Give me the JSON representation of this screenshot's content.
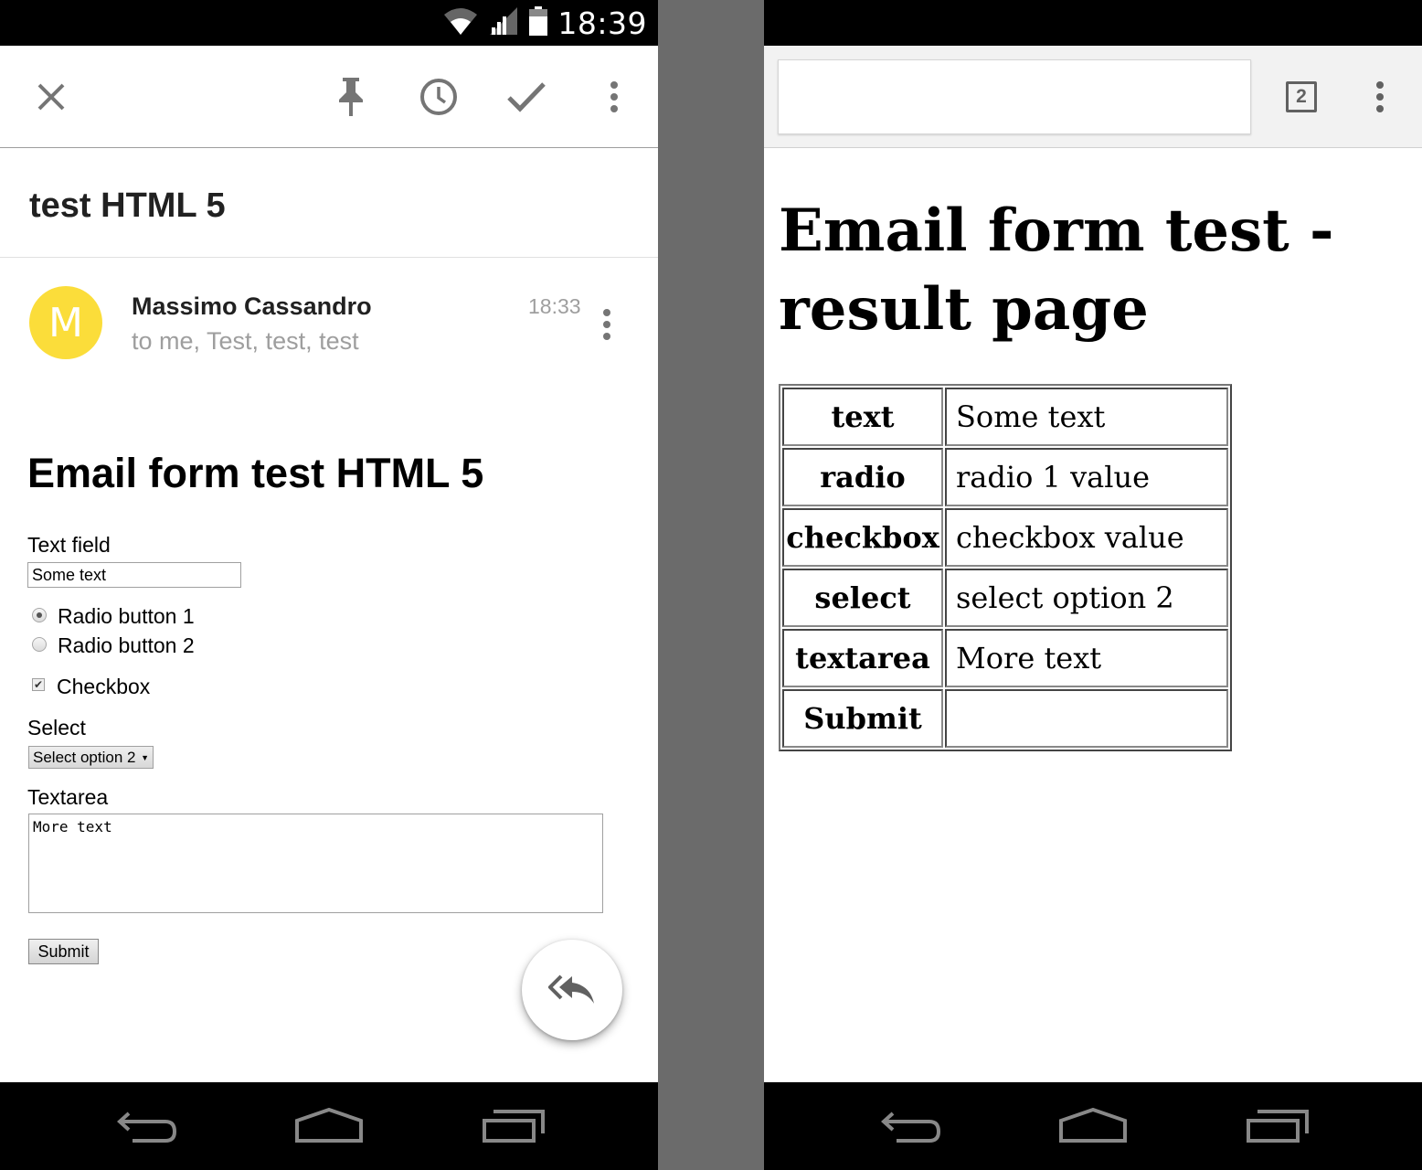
{
  "statusbar": {
    "time": "18:39"
  },
  "mail": {
    "subject": "test HTML 5",
    "sender": {
      "initial": "M",
      "name": "Massimo Cassandro",
      "recipients": "to me, Test, test, test",
      "time": "18:33",
      "avatar_color": "#fbdd3a"
    },
    "toolbar_icons": [
      "close-icon",
      "pin-icon",
      "clock-icon",
      "check-icon",
      "more-vert-icon"
    ],
    "body": {
      "title": "Email form test HTML 5",
      "text_field_label": "Text field",
      "text_field_value": "Some text",
      "radio_1_label": "Radio button 1",
      "radio_2_label": "Radio button 2",
      "radio_selected": 1,
      "checkbox_label": "Checkbox",
      "checkbox_checked": true,
      "select_label": "Select",
      "select_value": "Select option 2",
      "textarea_label": "Textarea",
      "textarea_value": "More text",
      "submit_label": "Submit"
    },
    "fab_icon": "reply-all-icon"
  },
  "browser": {
    "tab_count": "2",
    "url": "",
    "page_title": "Email form test - result page",
    "result_table": [
      {
        "key": "text",
        "value": "Some text"
      },
      {
        "key": "radio",
        "value": "radio 1 value"
      },
      {
        "key": "checkbox",
        "value": "checkbox value"
      },
      {
        "key": "select",
        "value": "select option 2"
      },
      {
        "key": "textarea",
        "value": "More text"
      },
      {
        "key": "Submit",
        "value": ""
      }
    ]
  },
  "navbar_icons": [
    "back-icon",
    "home-icon",
    "recents-icon"
  ]
}
